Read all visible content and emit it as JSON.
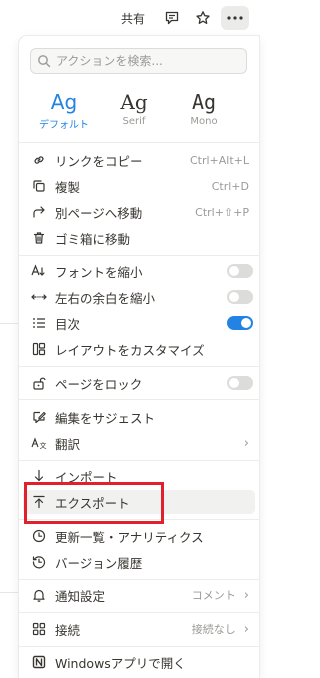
{
  "topbar": {
    "share_label": "共有"
  },
  "search": {
    "placeholder": "アクションを検索..."
  },
  "fonts": [
    {
      "sample": "Ag",
      "name": "デフォルト",
      "selected": true
    },
    {
      "sample": "Ag",
      "name": "Serif",
      "selected": false
    },
    {
      "sample": "Ag",
      "name": "Mono",
      "selected": false
    }
  ],
  "menu": {
    "copy_link": {
      "label": "リンクをコピー",
      "shortcut": "Ctrl+Alt+L"
    },
    "duplicate": {
      "label": "複製",
      "shortcut": "Ctrl+D"
    },
    "move_to": {
      "label": "別ページへ移動",
      "shortcut": "Ctrl+⇧+P"
    },
    "trash": {
      "label": "ゴミ箱に移動"
    },
    "small_text": {
      "label": "フォントを縮小",
      "enabled": false
    },
    "full_width": {
      "label": "左右の余白を縮小",
      "enabled": false
    },
    "toc": {
      "label": "目次",
      "enabled": true
    },
    "customize_layout": {
      "label": "レイアウトをカスタマイズ"
    },
    "lock_page": {
      "label": "ページをロック",
      "enabled": false
    },
    "suggest_edits": {
      "label": "編集をサジェスト"
    },
    "translate": {
      "label": "翻訳"
    },
    "import": {
      "label": "インポート"
    },
    "export": {
      "label": "エクスポート"
    },
    "updates": {
      "label": "更新一覧・アナリティクス"
    },
    "version_history": {
      "label": "バージョン履歴"
    },
    "notifications": {
      "label": "通知設定",
      "value": "コメント"
    },
    "connections": {
      "label": "接続",
      "value": "接続なし"
    },
    "open_in_app": {
      "label": "Windowsアプリで開く"
    }
  }
}
